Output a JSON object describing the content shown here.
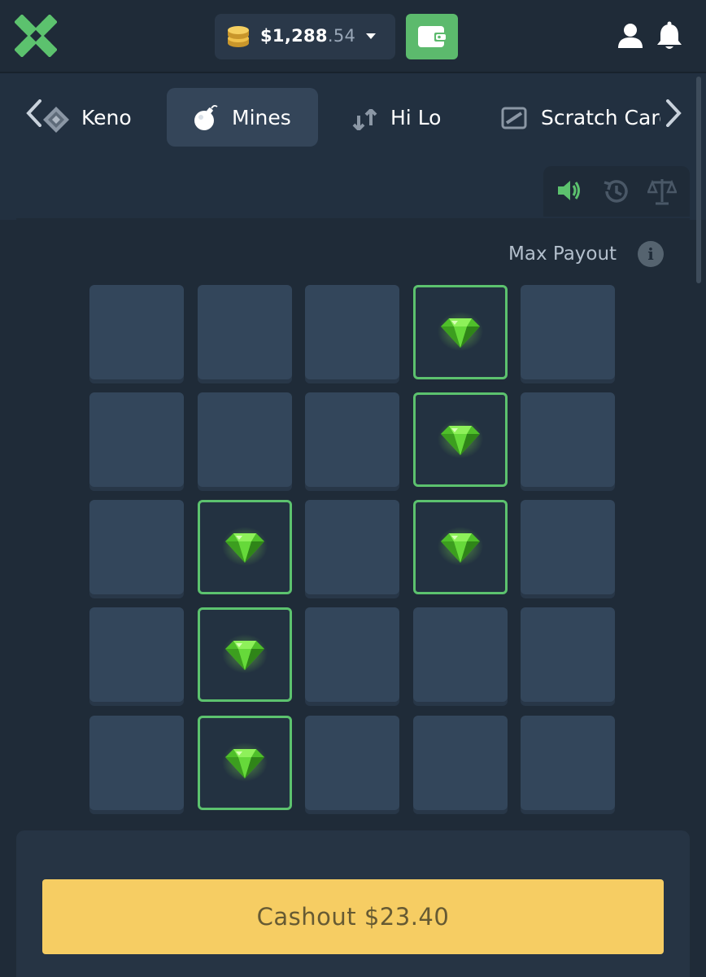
{
  "header": {
    "balance_main": "$1,288",
    "balance_decimal": ".54"
  },
  "tabs": [
    {
      "label": "Keno",
      "icon": "keno-icon",
      "active": false
    },
    {
      "label": "Mines",
      "icon": "bomb-icon",
      "active": true
    },
    {
      "label": "Hi Lo",
      "icon": "hilo-arrows-icon",
      "active": false
    },
    {
      "label": "Scratch Card",
      "icon": "scratch-card-icon",
      "active": false
    }
  ],
  "tools": [
    "sound-icon",
    "history-icon",
    "fairness-scale-icon"
  ],
  "board": {
    "max_payout_label": "Max Payout",
    "rows": 5,
    "cols": 5,
    "revealed_gems": [
      [
        0,
        3
      ],
      [
        1,
        3
      ],
      [
        2,
        1
      ],
      [
        2,
        3
      ],
      [
        3,
        1
      ],
      [
        4,
        1
      ]
    ]
  },
  "cashout": {
    "label": "Cashout $23.40"
  },
  "colors": {
    "background": "#1f2b38",
    "accent_green": "#5cc26e",
    "tile": "#33465b",
    "cashout_yellow": "#f6cd63"
  }
}
